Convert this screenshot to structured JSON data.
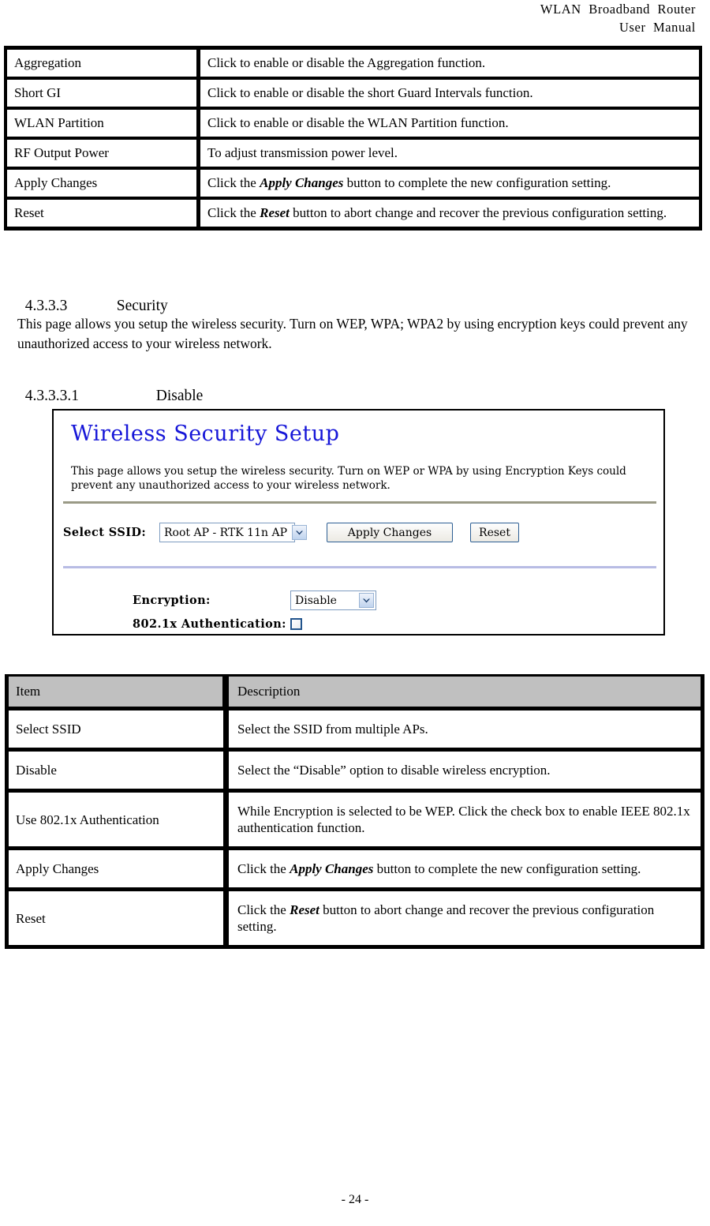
{
  "header": {
    "line1": "WLAN  Broadband  Router",
    "line2": "User  Manual"
  },
  "top_table": {
    "rows": [
      {
        "item": "Aggregation",
        "desc_prefix": "Click to enable or disable the Aggregation function.",
        "emphasis": "",
        "desc_suffix": ""
      },
      {
        "item": "Short GI",
        "desc_prefix": "Click to enable or disable the short Guard Intervals function.",
        "emphasis": "",
        "desc_suffix": ""
      },
      {
        "item": "WLAN Partition",
        "desc_prefix": "Click to enable or disable the WLAN Partition function.",
        "emphasis": "",
        "desc_suffix": ""
      },
      {
        "item": "RF Output Power",
        "desc_prefix": "To adjust transmission power level.",
        "emphasis": "",
        "desc_suffix": ""
      },
      {
        "item": "Apply Changes",
        "desc_prefix": "Click the ",
        "emphasis": "Apply Changes",
        "desc_suffix": " button to complete the new configuration setting."
      },
      {
        "item": "Reset",
        "desc_prefix": "Click the ",
        "emphasis": "Reset",
        "desc_suffix": " button to abort change and recover the previous configuration setting."
      }
    ]
  },
  "section_security": {
    "number": "4.3.3.3",
    "title": "Security",
    "paragraph": "This page allows you setup the wireless security. Turn on WEP, WPA; WPA2 by using encryption keys could prevent any unauthorized access to your wireless network."
  },
  "section_disable": {
    "number": "4.3.3.3.1",
    "title": "Disable"
  },
  "router_panel": {
    "title": "Wireless Security Setup",
    "description": "This page allows you setup the wireless security. Turn on WEP or WPA by using Encryption Keys could prevent any unauthorized access to your wireless network.",
    "select_ssid_label": "Select SSID:",
    "select_ssid_value": "Root AP - RTK 11n AP",
    "apply_changes_label": "Apply Changes",
    "reset_label": "Reset",
    "encryption_label": "Encryption:",
    "encryption_value": "Disable",
    "dot1x_label": "802.1x Authentication:",
    "title_color": "#1616d8",
    "rule1_color": "#9a9a86",
    "rule2_color": "#b8bce4",
    "control_border_color": "#7e9cc0",
    "button_border_color": "#2d5f94",
    "checkbox_border_color": "#22548c"
  },
  "bottom_table": {
    "header": {
      "item": "Item",
      "description": "Description"
    },
    "header_bg": "#c0c0c0",
    "rows": [
      {
        "item": "Select SSID",
        "desc_prefix": "Select the SSID from multiple APs.",
        "emphasis": "",
        "desc_suffix": ""
      },
      {
        "item": "Disable",
        "desc_prefix": "Select the “Disable” option to disable wireless encryption.",
        "emphasis": "",
        "desc_suffix": ""
      },
      {
        "item": "Use 802.1x Authentication",
        "desc_prefix": "While Encryption is selected to be WEP. Click the check box to enable IEEE 802.1x authentication function.",
        "emphasis": "",
        "desc_suffix": ""
      },
      {
        "item": "Apply Changes",
        "desc_prefix": "Click the ",
        "emphasis": "Apply Changes",
        "desc_suffix": " button to complete the new configuration setting."
      },
      {
        "item": "Reset",
        "desc_prefix": "Click the ",
        "emphasis": "Reset",
        "desc_suffix": " button to abort change and recover the previous configuration setting."
      }
    ]
  },
  "footer": {
    "page_label": "- 24 -"
  }
}
